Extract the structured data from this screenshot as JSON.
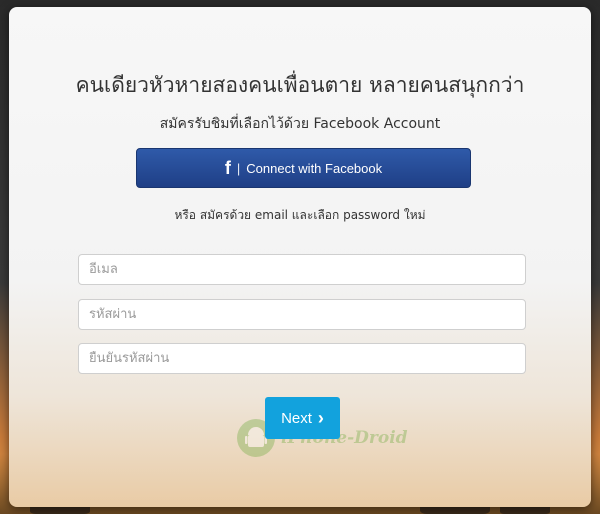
{
  "headline": "คนเดียวหัวหายสองคนเพื่อนตาย หลายคนสนุกกว่า",
  "subhead": "สมัครรับชิมที่เลือกไว้ด้วย Facebook Account",
  "facebook_button": {
    "icon": "f",
    "separator": "|",
    "label": "Connect with Facebook"
  },
  "or_text": "หรือ สมัครด้วย email และเลือก password ใหม่",
  "form": {
    "email_placeholder": "อีเมล",
    "password_placeholder": "รหัสผ่าน",
    "confirm_password_placeholder": "ยืนยันรหัสผ่าน"
  },
  "next_button": {
    "label": "Next",
    "icon": "chevron-right"
  },
  "watermark": {
    "text": "iPhone-Droid"
  },
  "colors": {
    "facebook_blue": "#2a4f9c",
    "next_blue": "#12a2dd"
  }
}
